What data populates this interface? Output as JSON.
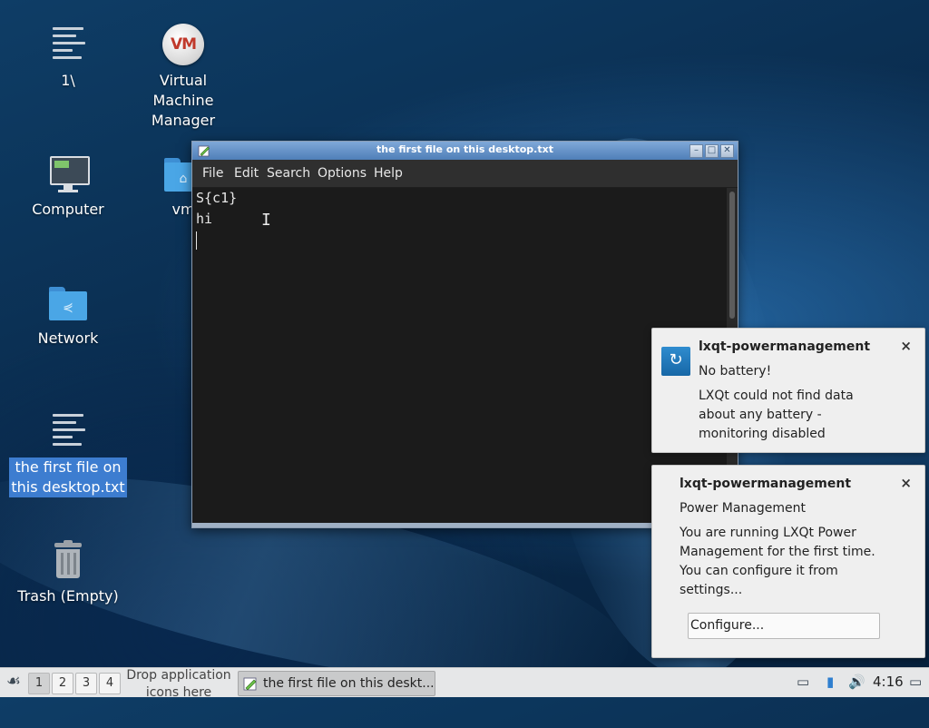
{
  "desktop": {
    "icons": [
      {
        "label": "1\\",
        "icon": "text-file-icon"
      },
      {
        "label": "Virtual Machine Manager",
        "icon": "virtual-machine-manager-icon",
        "line1": "Virtual",
        "line2": "Machine",
        "line3": "Manager",
        "badge": "VM"
      },
      {
        "label": "Computer",
        "icon": "computer-icon"
      },
      {
        "label": "vm",
        "icon": "home-folder-icon",
        "glyph": "⌂"
      },
      {
        "label": "Network",
        "icon": "network-folder-icon",
        "glyph": "⋞"
      },
      {
        "label": "the first file on this desktop.txt",
        "icon": "text-file-icon",
        "line1": "the first file on",
        "line2": "this desktop.txt",
        "selected": true
      },
      {
        "label": "Trash (Empty)",
        "icon": "trash-icon"
      }
    ]
  },
  "editor": {
    "title": "the first file on this desktop.txt",
    "window_buttons": {
      "minimize": "–",
      "maximize": "□",
      "close": "✕"
    },
    "menu": [
      "File",
      "Edit",
      "Search",
      "Options",
      "Help"
    ],
    "lines": [
      "S{c1}",
      "hi",
      ""
    ],
    "cursor_icon": "I"
  },
  "notifications": [
    {
      "app": "lxqt-powermanagement",
      "summary": "No battery!",
      "body_lines": [
        "LXQt could not find data",
        "about any battery -",
        "monitoring disabled"
      ],
      "close": "×",
      "icon": "lxqt-powermanagement-icon",
      "icon_glyph": "↻"
    },
    {
      "app": "lxqt-powermanagement",
      "summary": "Power Management",
      "body_lines": [
        "You are running LXQt Power",
        "Management for the first time.",
        "You can configure it from",
        "settings..."
      ],
      "close": "×",
      "action": "Configure..."
    }
  ],
  "taskbar": {
    "start_glyph": "☙",
    "desktops": [
      "1",
      "2",
      "3",
      "4"
    ],
    "active_desktop": "1",
    "drop_text_line1": "Drop application",
    "drop_text_line2": "icons here",
    "task_label": "the first file on this deskt...",
    "tray_icons": [
      "network-icon",
      "usb-drive-icon",
      "volume-icon"
    ],
    "tray_glyphs": {
      "network": "▭",
      "usb": "▮",
      "volume": "🔊"
    },
    "clock": "4:16",
    "show_desktop_glyph": "▭"
  }
}
